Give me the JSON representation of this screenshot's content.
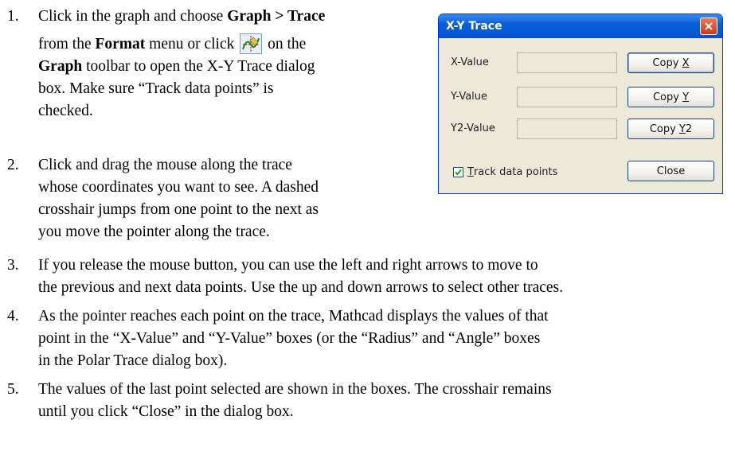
{
  "steps": [
    {
      "num": "1.",
      "lines": [
        {
          "a": "Click in the graph and choose ",
          "b": "Graph > Trace"
        },
        {
          "a": "from the ",
          "b": "Format",
          "c": " menu or click ",
          "d": " on the"
        },
        {
          "b": "Graph",
          "c": " toolbar to open the X-Y Trace dialog"
        },
        {
          "a": "box. Make sure “Track data points” is"
        },
        {
          "a": "checked."
        }
      ]
    },
    {
      "num": "2.",
      "lines": [
        "Click and drag the mouse along the trace",
        "whose coordinates you want to see. A dashed",
        "crosshair jumps from one point to the next as",
        "you move the pointer along the trace."
      ]
    },
    {
      "num": "3.",
      "lines": [
        "If you release the mouse button, you can use the left and right arrows to move to",
        "the previous and next data points. Use the up and down arrows to select other traces."
      ]
    },
    {
      "num": "4.",
      "lines": [
        "As the pointer reaches each point on the trace, Mathcad displays the values of that",
        "point in the “X-Value” and “Y-Value” boxes (or the “Radius” and “Angle” boxes",
        "in the Polar Trace dialog box)."
      ]
    },
    {
      "num": "5.",
      "lines": [
        "The values of the last point selected are shown in the boxes. The crosshair remains",
        "until you click “Close” in the dialog box."
      ]
    }
  ],
  "toolbar_icon": "graph-trace-icon",
  "dialog": {
    "title": "X-Y Trace",
    "x_label": "X-Value",
    "y_label": "Y-Value",
    "y2_label": "Y2-Value",
    "copy_x": {
      "pre": "Copy ",
      "mn": "X",
      "post": ""
    },
    "copy_y": {
      "pre": "Copy ",
      "mn": "Y",
      "post": ""
    },
    "copy_y2": {
      "pre": "Copy ",
      "mn": "Y",
      "post": "2"
    },
    "track": {
      "mn": "T",
      "rest": "rack data points"
    },
    "track_checked": true,
    "close_label": "Close",
    "accent": "#0558d4"
  }
}
